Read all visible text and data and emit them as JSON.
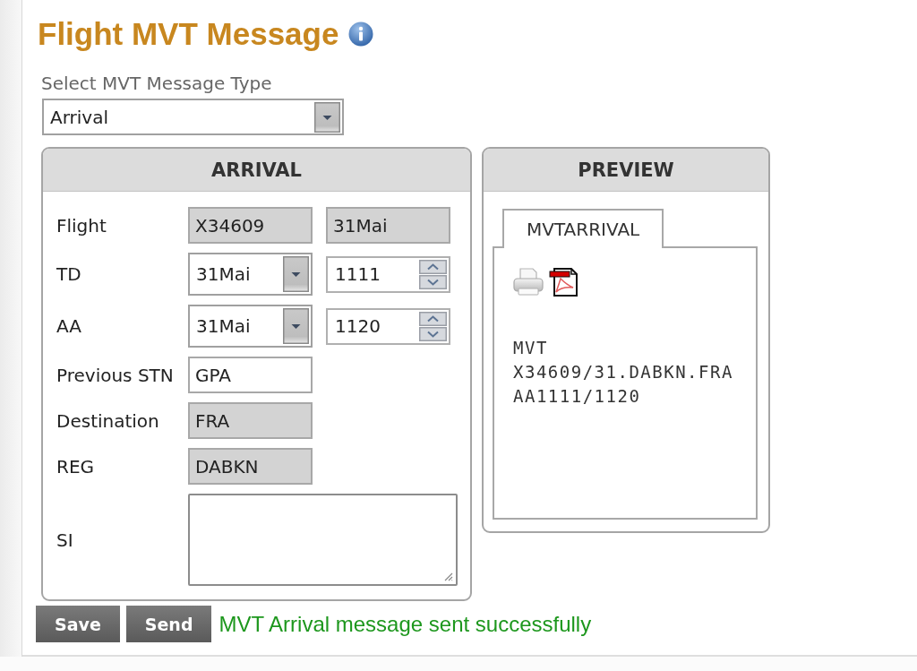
{
  "title": "Flight MVT Message",
  "message_type": {
    "label": "Select MVT Message Type",
    "value": "Arrival"
  },
  "arrival_panel": {
    "heading": "ARRIVAL",
    "fields": [
      {
        "label": "Flight",
        "kind": "inputs",
        "inputs": [
          {
            "value": "X34609",
            "readonly": true
          },
          {
            "value": "31Mai",
            "readonly": true
          }
        ]
      },
      {
        "label": "TD",
        "kind": "datetime",
        "date": "31Mai",
        "time": "1111"
      },
      {
        "label": "AA",
        "kind": "datetime",
        "date": "31Mai",
        "time": "1120"
      },
      {
        "label": "Previous STN",
        "kind": "inputs",
        "inputs": [
          {
            "value": "GPA",
            "readonly": false
          }
        ]
      },
      {
        "label": "Destination",
        "kind": "inputs",
        "inputs": [
          {
            "value": "FRA",
            "readonly": true
          }
        ]
      },
      {
        "label": "REG",
        "kind": "inputs",
        "inputs": [
          {
            "value": "DABKN",
            "readonly": true
          }
        ]
      },
      {
        "label": "SI",
        "kind": "textarea"
      }
    ]
  },
  "preview_panel": {
    "heading": "PREVIEW",
    "tabs": [
      {
        "label": "MVTARRIVAL",
        "selected": true
      }
    ],
    "message_lines": [
      "MVT",
      "X34609/31.DABKN.FRA",
      "AA1111/1120"
    ]
  },
  "buttons": [
    "Save",
    "Send"
  ],
  "status": {
    "kind": "success",
    "text": "MVT Arrival message sent successfully"
  }
}
